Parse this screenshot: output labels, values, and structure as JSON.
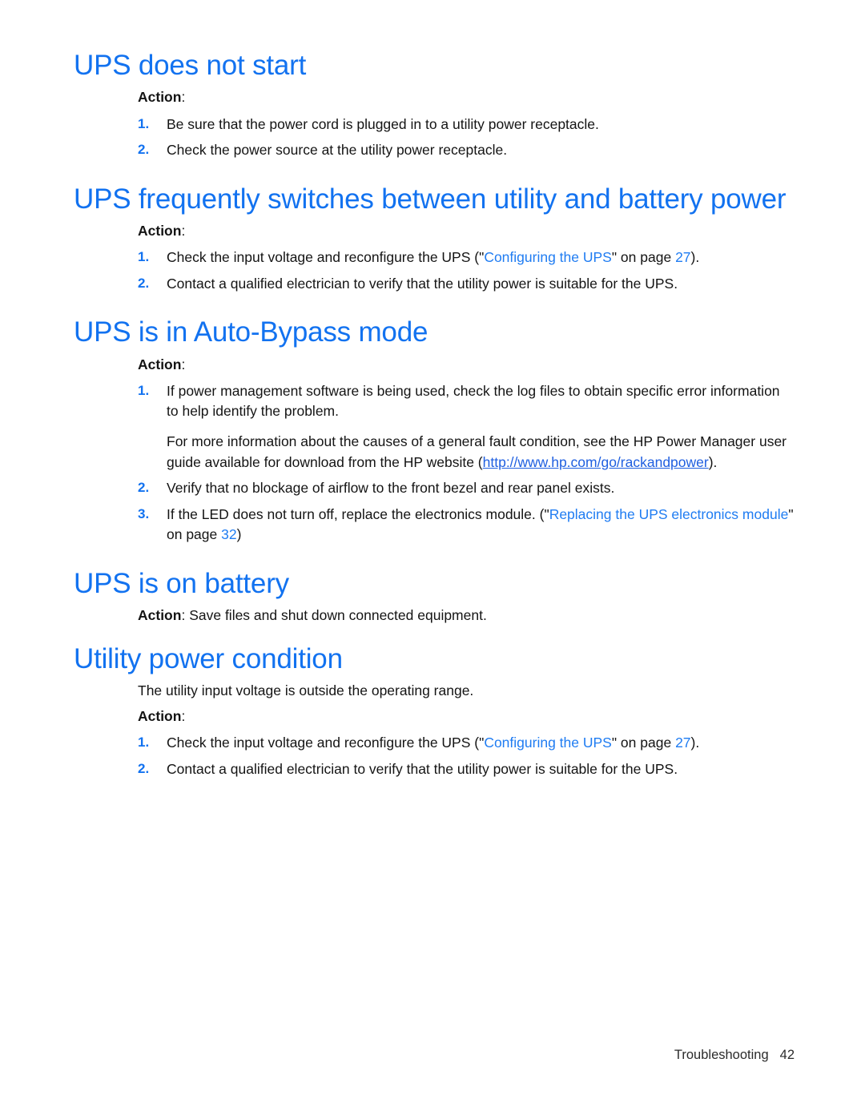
{
  "document": {
    "footer_label": "Troubleshooting",
    "footer_page": "42"
  },
  "colors": {
    "heading_blue": "#1272f0",
    "link_blue": "#1f7cf2",
    "url_blue": "#1f5fe0",
    "body_black": "#141414"
  },
  "sections": [
    {
      "title": "UPS does not start",
      "action_label": "Action",
      "action_colon": ":",
      "steps": [
        {
          "num": "1.",
          "text": "Be sure that the power cord is plugged in to a utility power receptacle."
        },
        {
          "num": "2.",
          "text": "Check the power source at the utility power receptacle."
        }
      ]
    },
    {
      "title": "UPS frequently switches between utility and battery power",
      "action_label": "Action",
      "action_colon": ":",
      "steps": [
        {
          "num": "1.",
          "pre": "Check the input voltage and reconfigure the UPS (\"",
          "link": "Configuring the UPS",
          "mid": "\" on page ",
          "page": "27",
          "post": ")."
        },
        {
          "num": "2.",
          "text": "Contact a qualified electrician to verify that the utility power is suitable for the UPS."
        }
      ]
    },
    {
      "title": "UPS is in Auto-Bypass mode",
      "action_label": "Action",
      "action_colon": ":",
      "steps": [
        {
          "num": "1.",
          "text": "If power management software is being used, check the log files to obtain specific error information to help identify the problem.",
          "sub_pre": "For more information about the causes of a general fault condition, see the HP Power Manager user guide available for download from the HP website (",
          "sub_url": "http://www.hp.com/go/rackandpower",
          "sub_post": ")."
        },
        {
          "num": "2.",
          "text": "Verify that no blockage of airflow to the front bezel and rear panel exists."
        },
        {
          "num": "3.",
          "pre": "If the LED does not turn off, replace the electronics module. (\"",
          "link": "Replacing the UPS electronics module",
          "mid": "\" on page ",
          "page": "32",
          "post": ")"
        }
      ]
    },
    {
      "title": "UPS is on battery",
      "action_label": "Action",
      "action_colon": ":",
      "action_inline": " Save files and shut down connected equipment."
    },
    {
      "title": "Utility power condition",
      "intro": "The utility input voltage is outside the operating range.",
      "action_label": "Action",
      "action_colon": ":",
      "steps": [
        {
          "num": "1.",
          "pre": "Check the input voltage and reconfigure the UPS (\"",
          "link": "Configuring the UPS",
          "mid": "\" on page ",
          "page": "27",
          "post": ")."
        },
        {
          "num": "2.",
          "text": "Contact a qualified electrician to verify that the utility power is suitable for the UPS."
        }
      ]
    }
  ]
}
